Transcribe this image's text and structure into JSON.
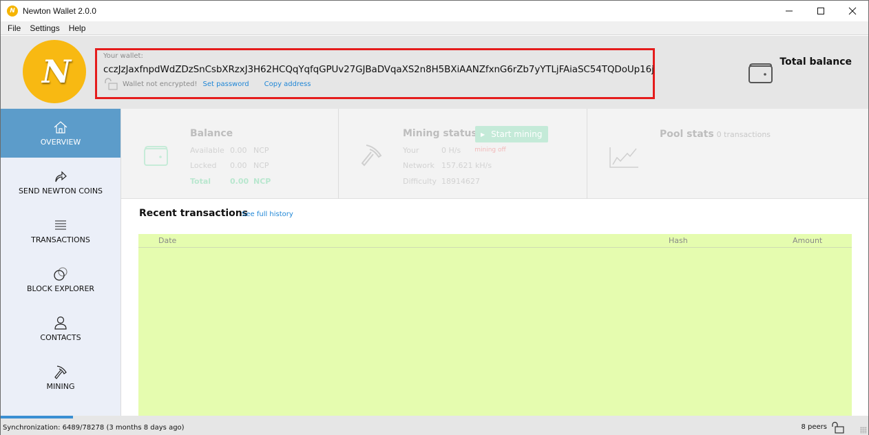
{
  "window": {
    "title": "Newton Wallet 2.0.0",
    "controls": {
      "minimize": "—",
      "maximize": "☐",
      "close": "✕"
    }
  },
  "menu": [
    "File",
    "Settings",
    "Help"
  ],
  "header": {
    "logo_text": "N",
    "wallet_label": "Your wallet:",
    "wallet_address": "cczJzJaxfnpdWdZDzSnCsbXRzxJ3H62HCQqYqfqGPUv27GJBaDVqaXS2n8H5BXiAANZfxnG6rZb7yYTLjFAiaSC54TQDoUp16j",
    "encryption_status": "Wallet not encrypted!",
    "set_password_link": "Set password",
    "copy_address_link": "Copy address",
    "total_balance_label": "Total balance"
  },
  "sidebar": {
    "items": [
      {
        "label": "OVERVIEW",
        "icon": "home-icon",
        "active": true
      },
      {
        "label": "SEND NEWTON COINS",
        "icon": "send-arrow-icon",
        "active": false
      },
      {
        "label": "TRANSACTIONS",
        "icon": "list-icon",
        "active": false
      },
      {
        "label": "BLOCK EXPLORER",
        "icon": "circles-icon",
        "active": false
      },
      {
        "label": "CONTACTS",
        "icon": "user-icon",
        "active": false
      },
      {
        "label": "MINING",
        "icon": "pickaxe-icon",
        "active": false
      }
    ]
  },
  "balance_card": {
    "title": "Balance",
    "rows": [
      {
        "label": "Available",
        "value": "0.00",
        "unit": "NCP"
      },
      {
        "label": "Locked",
        "value": "0.00",
        "unit": "NCP"
      },
      {
        "label": "Total",
        "value": "0.00",
        "unit": "NCP"
      }
    ],
    "total_color": "#b9e7cf"
  },
  "mining_card": {
    "title": "Mining status",
    "start_button": "Start mining",
    "rows": [
      {
        "label": "Your",
        "value": "0 H/s",
        "status": "mining off"
      },
      {
        "label": "Network",
        "value": "157.621 kH/s"
      },
      {
        "label": "Difficulty",
        "value": "18914627"
      }
    ]
  },
  "pool_card": {
    "title": "Pool stats",
    "subtitle": "0 transactions"
  },
  "recent": {
    "title": "Recent transactions",
    "see_history": "See full history",
    "columns": [
      "Date",
      "Hash",
      "Amount"
    ],
    "rows": []
  },
  "status": {
    "sync_text": "Synchronization: 6489/78278 (3 months 8 days ago)",
    "sync_progress": 0.083,
    "peers": "8 peers"
  },
  "colors": {
    "accent": "#5c9cca",
    "link": "#1f86d6",
    "highlight_border": "#e51c1c",
    "logo": "#f8b912",
    "table_bg": "#e5fcaf",
    "progress": "#3a8fd3"
  }
}
